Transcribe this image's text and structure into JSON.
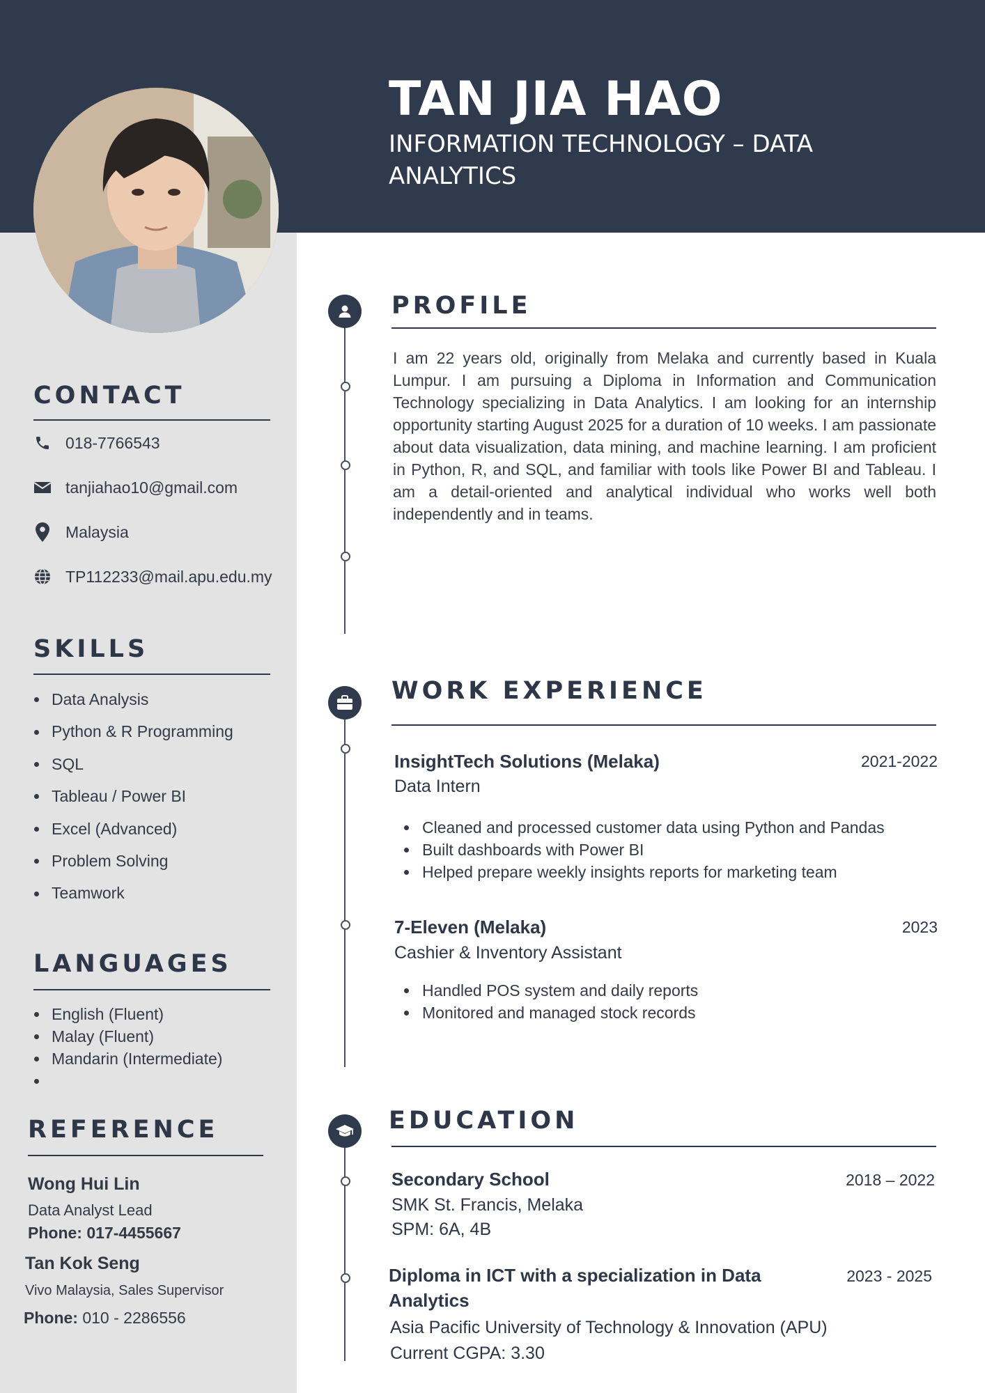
{
  "header": {
    "name": "TAN JIA HAO",
    "subtitle": "INFORMATION TECHNOLOGY – DATA ANALYTICS"
  },
  "contact": {
    "heading": "CONTACT",
    "phone": "018-7766543",
    "email": "tanjiahao10@gmail.com",
    "location": "Malaysia",
    "website": "TP112233@mail.apu.edu.my"
  },
  "skills": {
    "heading": "SKILLS",
    "items": [
      "Data Analysis",
      "Python & R Programming",
      "SQL",
      "Tableau / Power BI",
      "Excel (Advanced)",
      "Problem Solving",
      "Teamwork"
    ]
  },
  "languages": {
    "heading": "LANGUAGES",
    "items": [
      "English (Fluent)",
      "Malay (Fluent)",
      "Mandarin (Intermediate)",
      ""
    ]
  },
  "reference": {
    "heading": "REFERENCE",
    "refs": [
      {
        "name": "Wong Hui Lin",
        "role": "Data Analyst Lead",
        "phone_label": "Phone:",
        "phone": "017-4455667"
      },
      {
        "name": "Tan Kok Seng",
        "role": "Vivo Malaysia, Sales Supervisor",
        "phone_label": "Phone:",
        "phone": "010 - 2286556"
      }
    ]
  },
  "profile": {
    "heading": "PROFILE",
    "text": "I am 22 years old, originally from Melaka and currently based in Kuala Lumpur. I am pursuing a Diploma in Information and Communication Technology specializing in Data Analytics. I am looking for an internship opportunity starting August 2025 for a duration of 10 weeks. I am passionate about data visualization, data mining, and machine learning. I am proficient in Python, R, and SQL, and familiar with tools like Power BI and Tableau. I am a detail-oriented and analytical individual who works well both independently and in teams."
  },
  "work": {
    "heading": "WORK EXPERIENCE",
    "jobs": [
      {
        "company": "InsightTech Solutions (Melaka)",
        "date": "2021-2022",
        "role": "Data Intern",
        "bullets": [
          "Cleaned and processed customer data using Python and Pandas",
          "Built dashboards with Power BI",
          "Helped prepare weekly insights reports for marketing team"
        ]
      },
      {
        "company": "7-Eleven (Melaka)",
        "date": "2023",
        "role": "Cashier & Inventory Assistant",
        "bullets": [
          "Handled POS system and daily reports",
          "Monitored and managed stock records"
        ]
      }
    ]
  },
  "education": {
    "heading": "EDUCATION",
    "entries": [
      {
        "title": "Secondary School",
        "date": "2018 – 2022",
        "school": "SMK St. Francis, Melaka",
        "result": "SPM: 6A, 4B"
      },
      {
        "title_line1": "Diploma in ICT with a specialization in Data",
        "title_line2": "Analytics",
        "date": "2023 - 2025",
        "school": "Asia Pacific University of Technology & Innovation (APU)",
        "result": "Current CGPA: 3.30"
      }
    ]
  },
  "icons": {
    "phone": "phone-icon",
    "email": "envelope-icon",
    "location": "map-pin-icon",
    "website": "globe-icon",
    "profile": "user-icon",
    "work": "briefcase-icon",
    "education": "graduation-cap-icon"
  },
  "colors": {
    "header_bg": "#303a4d",
    "sidebar_bg": "#e3e3e4",
    "text": "#333a46"
  }
}
